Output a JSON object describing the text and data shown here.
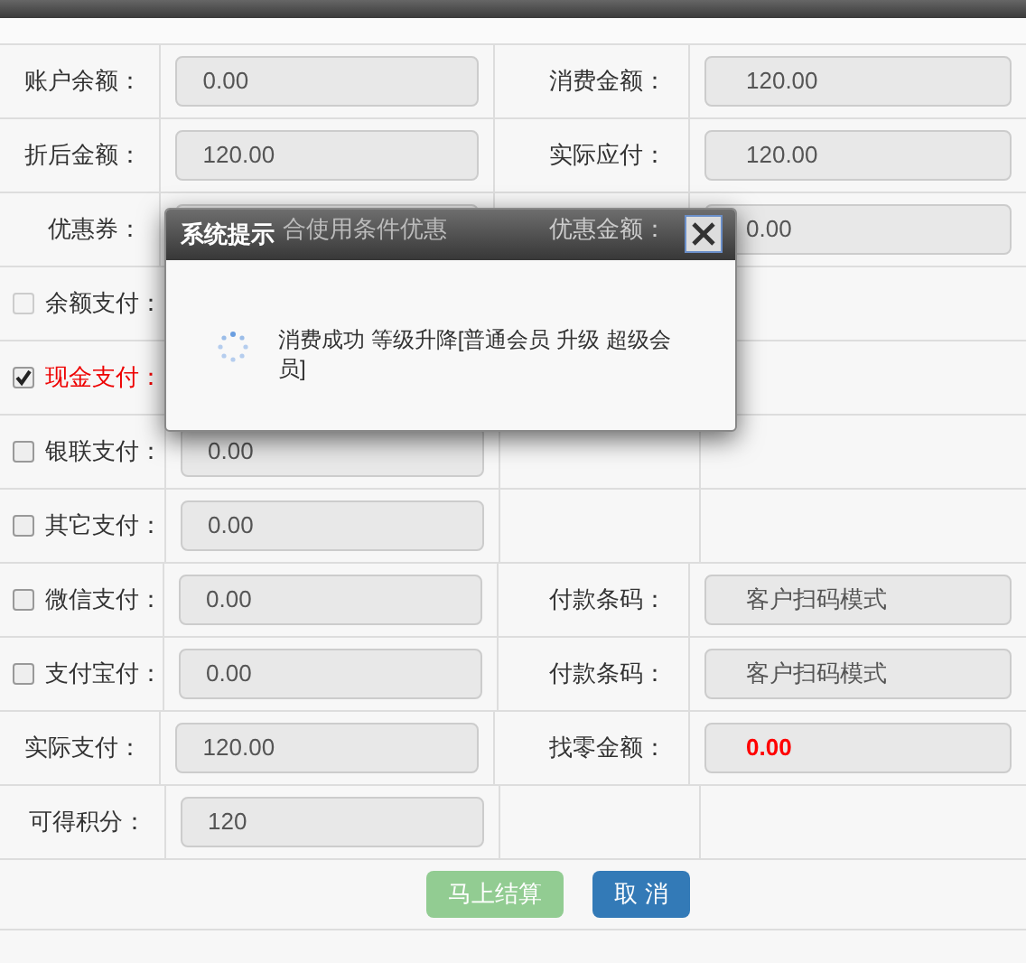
{
  "rows": [
    {
      "left": {
        "kind": "label",
        "label": "账户余额："
      },
      "field": {
        "kind": "input",
        "value": "0.00"
      },
      "right_label": "消费金额：",
      "right_field": {
        "kind": "input",
        "value": "120.00"
      }
    },
    {
      "left": {
        "kind": "label",
        "label": "折后金额："
      },
      "field": {
        "kind": "input",
        "value": "120.00"
      },
      "right_label": "实际应付：",
      "right_field": {
        "kind": "input",
        "value": "120.00"
      }
    },
    {
      "left": {
        "kind": "label",
        "label": "优惠券："
      },
      "field": {
        "kind": "select",
        "value": "合使用条件优惠"
      },
      "right_label": "优惠金额：",
      "right_field": {
        "kind": "input",
        "value": "0.00"
      }
    },
    {
      "left": {
        "kind": "checkbox",
        "label": "余额支付：",
        "checked": false,
        "disabled": true
      }
    },
    {
      "left": {
        "kind": "checkbox",
        "label": "现金支付：",
        "checked": true,
        "disabled": false
      }
    },
    {
      "left": {
        "kind": "checkbox",
        "label": "银联支付：",
        "checked": false,
        "disabled": false
      },
      "field": {
        "kind": "input",
        "value": "0.00"
      }
    },
    {
      "left": {
        "kind": "checkbox",
        "label": "其它支付：",
        "checked": false,
        "disabled": false
      },
      "field": {
        "kind": "input",
        "value": "0.00"
      }
    },
    {
      "left": {
        "kind": "checkbox",
        "label": "微信支付：",
        "checked": false,
        "disabled": false
      },
      "field": {
        "kind": "input",
        "value": "0.00"
      },
      "right_label": "付款条码：",
      "right_field": {
        "kind": "input",
        "value": "客户扫码模式"
      }
    },
    {
      "left": {
        "kind": "checkbox",
        "label": "支付宝付：",
        "checked": false,
        "disabled": false
      },
      "field": {
        "kind": "input",
        "value": "0.00"
      },
      "right_label": "付款条码：",
      "right_field": {
        "kind": "input",
        "value": "客户扫码模式"
      }
    },
    {
      "left": {
        "kind": "label",
        "label": "实际支付："
      },
      "field": {
        "kind": "input",
        "value": "120.00"
      },
      "right_label": "找零金额：",
      "right_field": {
        "kind": "input",
        "value": "0.00",
        "highlight": true
      }
    },
    {
      "left": {
        "kind": "label",
        "label": "可得积分："
      },
      "field": {
        "kind": "input",
        "value": "120"
      }
    }
  ],
  "buttons": [
    {
      "label": "马上结算",
      "kind": "success",
      "disabled": true
    },
    {
      "label": "取 消",
      "kind": "primary",
      "disabled": false
    }
  ],
  "dialog": {
    "title": "系统提示",
    "message": "消费成功 等级升降[普通会员 升级 超级会员]"
  }
}
